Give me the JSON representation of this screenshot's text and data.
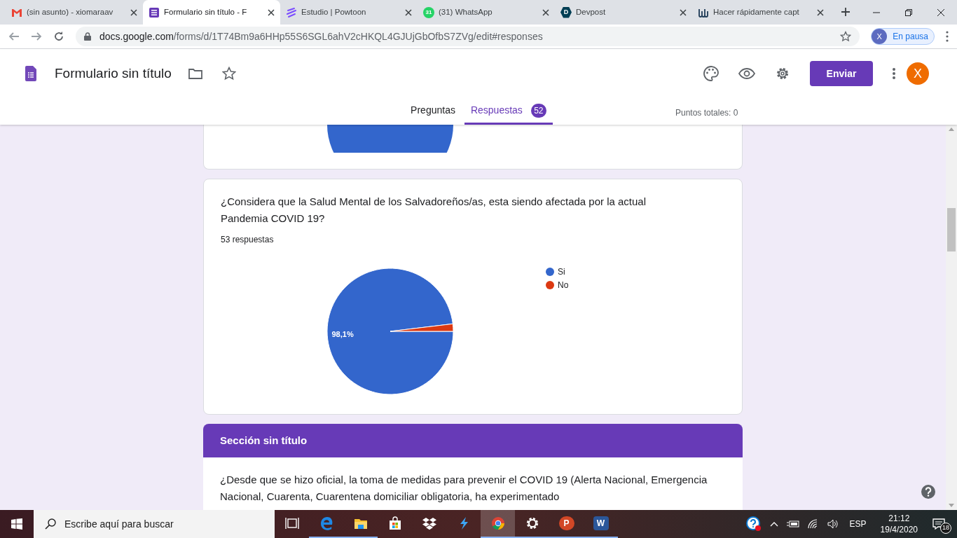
{
  "browser_tabs": [
    {
      "kind": "gmail",
      "title": "(sin asunto) - xiomaraav",
      "selected": false
    },
    {
      "kind": "forms",
      "title": "Formulario sin título - F",
      "selected": true
    },
    {
      "kind": "powtoon",
      "title": "Estudio | Powtoon",
      "selected": false
    },
    {
      "kind": "whatsapp",
      "title": "(31) WhatsApp",
      "badge": "31",
      "selected": false
    },
    {
      "kind": "devpost",
      "title": "Devpost",
      "logo_text": "D",
      "selected": false
    },
    {
      "kind": "capture",
      "title": "Hacer rápidamente capt",
      "selected": false
    }
  ],
  "address_bar": {
    "host": "docs.google.com",
    "path": "/forms/d/1T74Bm9a6HHp55S6SGL6ahV2cHKQL4GJUjGbOfbS7ZVg/edit#responses"
  },
  "profile": {
    "initial": "X",
    "label": "En pausa"
  },
  "form_header": {
    "title": "Formulario sin título",
    "send": "Enviar",
    "avatar": "X",
    "tabs": [
      {
        "label": "Preguntas",
        "selected": false
      },
      {
        "label": "Respuestas",
        "selected": true,
        "badge": "52"
      }
    ],
    "points": "Puntos totales: 0"
  },
  "cards": [
    {
      "kind": "chart_tail"
    },
    {
      "kind": "question",
      "question": "¿Considera que la Salud Mental de los Salvadoreños/as, esta siendo afectada por la actual Pandemia COVID 19?",
      "responses": "53 respuestas",
      "chart_data": {
        "type": "pie",
        "categories": [
          "Si",
          "No"
        ],
        "values": [
          98.1,
          1.9
        ],
        "colors": [
          "#3366cc",
          "#dc3912"
        ],
        "value_labels": [
          "98,1%",
          null
        ],
        "legend": "right"
      }
    },
    {
      "kind": "section",
      "title": "Sección sin título",
      "question": "¿Desde que se hizo oficial, la toma de medidas para prevenir el COVID 19 (Alerta Nacional, Emergencia Nacional, Cuarenta, Cuarentena domiciliar obligatoria, ha experimentado"
    }
  ],
  "taskbar": {
    "search": "Escribe aquí para buscar",
    "apps": [
      {
        "kind": "taskview",
        "running": false,
        "selected": false
      },
      {
        "kind": "edge",
        "running": true,
        "selected": false
      },
      {
        "kind": "explorer",
        "running": true,
        "selected": false
      },
      {
        "kind": "store",
        "running": false,
        "selected": false
      },
      {
        "kind": "dropbox",
        "running": false,
        "selected": false
      },
      {
        "kind": "bolt",
        "running": false,
        "selected": false
      },
      {
        "kind": "chrome",
        "running": true,
        "selected": true
      },
      {
        "kind": "settings",
        "running": true,
        "selected": false
      },
      {
        "kind": "powerpoint",
        "logo_text": "P",
        "running": true,
        "selected": false
      },
      {
        "kind": "word",
        "logo_text": "W",
        "running": true,
        "selected": false
      }
    ],
    "language": "ESP",
    "time": "21:12",
    "date": "19/4/2020",
    "notifications": "18"
  }
}
